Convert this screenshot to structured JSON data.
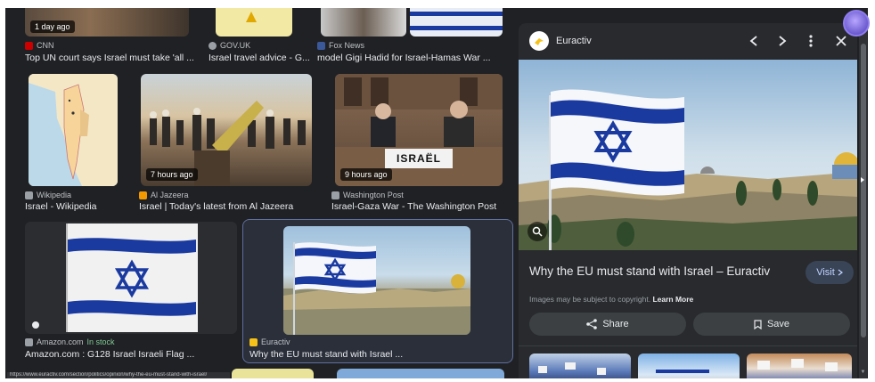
{
  "grid": {
    "row1": [
      {
        "badge": "1 day ago",
        "source": "CNN",
        "caption": "Top UN court says Israel must take 'all ...",
        "favicon_color": "#cc0000"
      },
      {
        "source": "GOV.UK",
        "caption": "Israel travel advice - G...",
        "favicon_color": "#9aa0a6"
      },
      {
        "source": "Fox News",
        "caption": "model Gigi Hadid for Israel-Hamas War ...",
        "favicon_color": "#3b5998"
      }
    ],
    "row2": [
      {
        "source": "Wikipedia",
        "caption": "Israel - Wikipedia",
        "favicon_color": "#9aa0a6"
      },
      {
        "badge": "7 hours ago",
        "source": "Al Jazeera",
        "caption": "Israel | Today's latest from Al Jazeera",
        "favicon_color": "#f29900"
      },
      {
        "badge": "9 hours ago",
        "source": "Washington Post",
        "caption": "Israel-Gaza War - The Washington Post",
        "favicon_color": "#9aa0a6",
        "sign_text": "ISRAËL"
      }
    ],
    "row3": [
      {
        "source": "Amazon.com",
        "stock": "In stock",
        "caption": "Amazon.com : G128 Israel Israeli Flag ...",
        "favicon_color": "#9aa0a6"
      },
      {
        "source": "Euractiv",
        "caption": "Why the EU must stand with Israel ...",
        "favicon_color": "#f6c21a"
      }
    ],
    "status_url": "https://www.euractiv.com/section/politics/opinion/why-the-eu-must-stand-with-israel/"
  },
  "panel": {
    "source": "Euractiv",
    "icons": [
      "chevron-left-icon",
      "chevron-right-icon",
      "more-vert-icon",
      "close-icon"
    ],
    "title": "Why the EU must stand with Israel – Euractiv",
    "visit_label": "Visit",
    "copyright_notice": "Images may be subject to copyright.",
    "learn_more": "Learn More",
    "share_label": "Share",
    "save_label": "Save"
  },
  "colors": {
    "background": "#202124",
    "panel": "#282a2d",
    "accent": "#394457",
    "flag_blue": "#1a3aa0"
  }
}
